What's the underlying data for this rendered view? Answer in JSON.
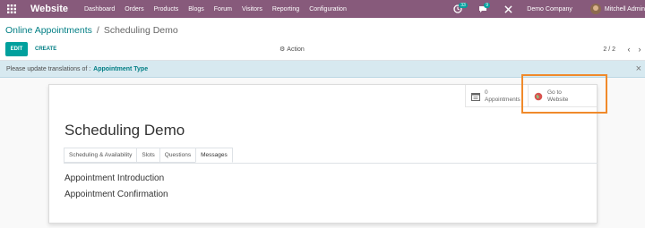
{
  "navbar": {
    "brand": "Website",
    "menu": [
      "Dashboard",
      "Orders",
      "Products",
      "Blogs",
      "Forum",
      "Visitors",
      "Reporting",
      "Configuration"
    ],
    "chat_badge": "33",
    "activity_badge": "9",
    "company": "Demo Company",
    "user": "Mitchell Admin"
  },
  "control": {
    "breadcrumb_parent": "Online Appointments",
    "breadcrumb_sep": "/",
    "breadcrumb_current": "Scheduling Demo",
    "edit_label": "EDIT",
    "create_label": "CREATE",
    "action_label": "Action",
    "pager": "2 / 2"
  },
  "alert": {
    "text": "Please update translations of :",
    "link": "Appointment Type"
  },
  "sheet": {
    "appointments_count": "0",
    "appointments_label": "Appointments",
    "website_line1": "Go to",
    "website_line2": "Website",
    "title": "Scheduling Demo",
    "tabs": [
      "Scheduling & Availability",
      "Slots",
      "Questions",
      "Messages"
    ],
    "active_tab": "Messages",
    "messages": [
      "Appointment Introduction",
      "Appointment Confirmation"
    ]
  },
  "colors": {
    "navbar": "#875a7b",
    "primary": "#00a09d",
    "link": "#017e84",
    "highlight": "#f08a2b",
    "alert_bg": "#d7e9f0"
  }
}
